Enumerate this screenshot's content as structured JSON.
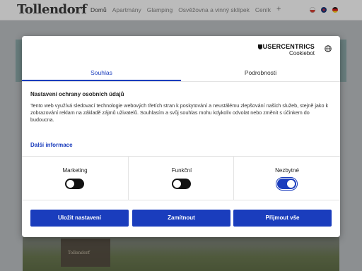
{
  "site": {
    "logo": "Tollendorf",
    "nav": [
      "Domů",
      "Apartmány",
      "Glamping",
      "Osvěžovna a vinný sklípek",
      "Ceník"
    ],
    "nav_plus": "+",
    "photo_sign": "Tollendorf"
  },
  "consent": {
    "brand": "USERCENTRICS",
    "brand_sub": "Cookiebot",
    "tabs": [
      "Souhlas",
      "Podrobnosti"
    ],
    "title": "Nastavení ochrany osobních údajů",
    "description": "Tento web využívá sledovací technologie webových třetích stran k poskytování a neustálému zlepšování našich služeb, stejně jako k zobrazování reklam na základě zájmů uživatelů. Souhlasím a svůj souhlas mohu kdykoliv odvolat nebo změnit s účinkem do budoucna.",
    "more_link": "Další informace",
    "categories": [
      {
        "label": "Marketing",
        "enabled": false
      },
      {
        "label": "Funkční",
        "enabled": false
      },
      {
        "label": "Nezbytné",
        "enabled": true
      }
    ],
    "buttons": {
      "save": "Uložit nastavení",
      "reject": "Zamítnout",
      "accept_all": "Přijmout vše"
    },
    "accent_color": "#1a3dbd"
  }
}
